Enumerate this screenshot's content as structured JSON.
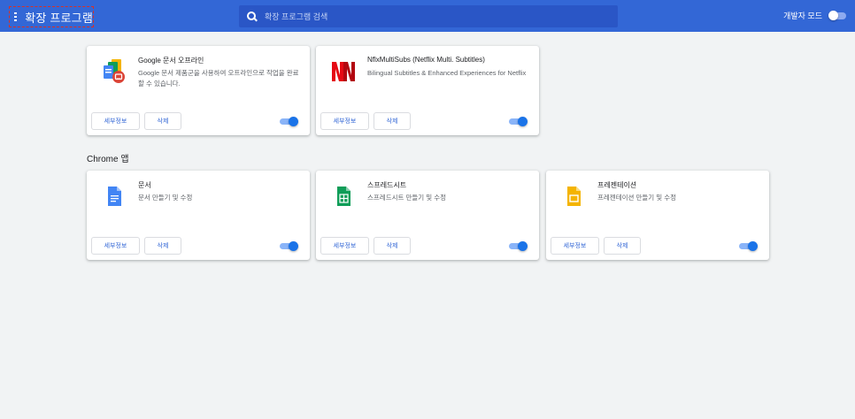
{
  "header": {
    "title": "확장 프로그램",
    "search_placeholder": "확장 프로그램 검색",
    "dev_mode_label": "개발자 모드",
    "dev_mode_enabled": false,
    "background": "#3367d6"
  },
  "extensions": [
    {
      "name": "Google 문서 오프라인",
      "description": "Google 문서 제품군을 사용하여 오프라인으로 작업을 완료할 수 있습니다.",
      "icon": "google-docs-offline-icon",
      "details_label": "세부정보",
      "remove_label": "삭제",
      "enabled": true
    },
    {
      "name": "NflxMultiSubs (Netflix Multi. Subtitles)",
      "description": "Bilingual Subtitles & Enhanced Experiences for Netflix",
      "icon": "netflix-multisubs-icon",
      "details_label": "세부정보",
      "remove_label": "삭제",
      "enabled": true
    }
  ],
  "chrome_apps_section": {
    "title": "Chrome 앱",
    "apps": [
      {
        "name": "문서",
        "description": "문서 만들기 및 수정",
        "icon": "docs-icon",
        "details_label": "세부정보",
        "remove_label": "삭제",
        "enabled": true
      },
      {
        "name": "스프레드시트",
        "description": "스프레드시트 만들기 및 수정",
        "icon": "sheets-icon",
        "details_label": "세부정보",
        "remove_label": "삭제",
        "enabled": true
      },
      {
        "name": "프레젠테이션",
        "description": "프레젠테이션 만들기 및 수정",
        "icon": "slides-icon",
        "details_label": "세부정보",
        "remove_label": "삭제",
        "enabled": true
      }
    ]
  },
  "colors": {
    "accent": "#1a73e8",
    "docs_blue": "#4285f4",
    "sheets_green": "#0f9d58",
    "slides_yellow": "#f4b400",
    "netflix_red": "#e50914"
  }
}
